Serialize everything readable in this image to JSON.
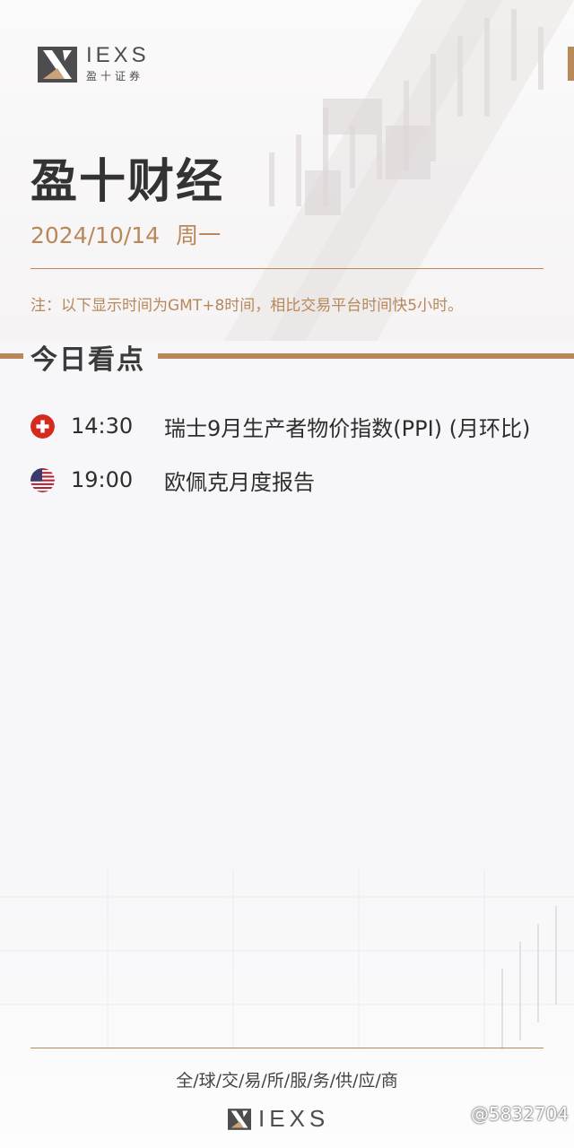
{
  "brand": {
    "wordmark": "IEXS",
    "sub": "盈十证券"
  },
  "header": {
    "title": "盈十财经",
    "date": "2024/10/14",
    "weekday": "周一",
    "note": "注：以下显示时间为GMT+8时间，相比交易平台时间快5小时。"
  },
  "section": {
    "title": "今日看点"
  },
  "events": [
    {
      "flag": "switzerland-flag-icon",
      "time": "14:30",
      "title": "瑞士9月生产者物价指数(PPI) (月环比)"
    },
    {
      "flag": "usa-flag-icon",
      "time": "19:00",
      "title": "欧佩克月度报告"
    }
  ],
  "footer": {
    "tagline": "全/球/交/易/所/服/务/供/应/商",
    "wordmark": "IEXS"
  },
  "watermark": "@5832704",
  "colors": {
    "accent": "#b8885a",
    "text": "#333333",
    "background": "#f7f6f8"
  }
}
